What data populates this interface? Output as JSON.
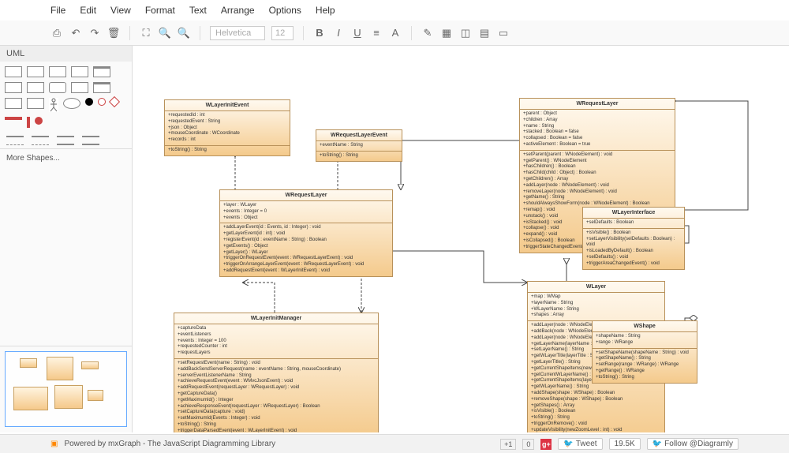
{
  "menu": {
    "file": "File",
    "edit": "Edit",
    "view": "View",
    "format": "Format",
    "text": "Text",
    "arrange": "Arrange",
    "options": "Options",
    "help": "Help"
  },
  "toolbar": {
    "font": "Helvetica",
    "size": "12"
  },
  "sidebar": {
    "title": "UML",
    "more": "More Shapes..."
  },
  "uml_boxes": {
    "wlayerInitEvent": {
      "title": "WLayerInitEvent",
      "attrs": "+requestedId : int\n+requestedEvent : String\n+json : Object\n+mouseCoordinate : WCoordinate\n+records : int",
      "ops": "+toString() : String"
    },
    "wRequestLayerEvent": {
      "title": "WRequestLayerEvent",
      "attrs": "+eventName : String",
      "ops": "+toString() : String"
    },
    "wRequestLayer": {
      "title": "WRequestLayer",
      "attrs": "+layer : WLayer\n+events : Integer = 0\n+events : Object",
      "ops": "+addLayerEvent(id : Events, id : Integer) : void\n+getLayerEvent(id : int) : void\n+registerEvent(id : eventName : String) : Boolean\n+getEvents() : Object\n+getLayer() : WLayer\n+triggerOnRequestEvent(event : WRequestLayerEvent) : void\n+triggerOnArrangeLayerEvent(event : WRequestLayerEvent) : void\n+addRequestEvent(event : WLayerInitEvent) : void"
    },
    "wRequestLayer2": {
      "title": "WRequestLayer",
      "attrs": "+parent : Object\n+children : Array\n+name : String\n+stacked : Boolean = false\n+collapsed : Boolean = false\n+activeElement : Boolean = true",
      "ops": "+setParent(parent : WNodeElement) : void\n+getParent() : WNodeElement\n+hasChildren() : Boolean\n+hasChild(child : Object) : Boolean\n+getChildren() : Array\n+addLayer(node : WNodeElement) : void\n+removeLayer(node : WNodeElement) : void\n+getName() : String\n+shouldAlwaysShowForm(node : WNodeElement) : Boolean\n+remap() : void\n+unstack() : void\n+isStacked() : void\n+collapse() : void\n+expand() : void\n+isCollapsed() : Boolean\n+triggerStateChangedEvent() : void"
    },
    "wLayerInterface": {
      "title": "WLayerInterface",
      "attrs": "+selDefaults : Boolean",
      "ops": "+isVisible() : Boolean\n+setLayerVisibility(selDefaults : Boolean) : void\n+isLoadedByDefault() : Boolean\n+selDefaults() : void\n+triggerAreaChangedEvent() : void"
    },
    "wLayerInitManager": {
      "title": "WLayerInitManager",
      "attrs": "+captureData\n+eventListeners\n+events : Integer = 100\n+requestedCounter : int\n+requestLayers",
      "ops": "+setRequestEvent(name : String) : void\n+addBackSendServerRequest(name : eventName : String, mouseCoordinate)\n+serverEventListenerName : String\n+achieveRequestEvent(event : WMvcJsonEvent) : void\n+addRequestEvent(requestLayer : WRequestLayer) : void\n+getCaptureData()\n+getMaximumId() : Integer\n+achieveResponseEvent(requestLayer : WRequestLayer) : Boolean\n+setCaptureData(capture : void)\n+setMaximumId(Events : Integer) : void\n+toString() : String\n+triggerDataParsedEvent(event : WLayerInitEvent) : void"
    },
    "wLayer": {
      "title": "WLayer",
      "attrs": "+map : WMap\n+layerName : String\n+WLayerName : String\n+shapes : Array",
      "ops": "+addLayer(node : WNodeElement) : void\n+addBack(node : WNodeElement) : void\n+addLayer(node : WNodeElement) : void\n+getLayerName(layerName : String) : void\n+setLayerName() : String\n+getWLayerTitle(layerTitle : String) : void\n+getLayerTitle() : String\n+getCurrentShapeItems(newZoomLevel : int) : String\n+getCurrentWLayerName() : String\n+getCurrentShapeItems(layerName : String) : void\n+getWLayerName() : String\n+addShape(shape : WShape) : Boolean\n+removeShape(shape : WShape) : Boolean\n+getShapes() : Array\n+isVisible() : Boolean\n+toString() : String\n+triggerOnRemove() : void\n+updateVisibility(newZoomLevel : int) : void\n+updateParentVisibility(parent : WNodeElement) : void"
    },
    "wShape": {
      "title": "WShape",
      "attrs": "+shapeName : String\n+range : WRange",
      "ops": "+setShapeName(shapeName : String) : void\n+getShapeName() : String\n+setRange(range : WRange) : WRange\n+getRange() : WRange\n+toString() : String"
    }
  },
  "footer": {
    "powered": "Powered by mxGraph - The JavaScript Diagramming Library",
    "plus1_count": "0",
    "tweet": "Tweet",
    "tweet_count": "19.5K",
    "follow": "Follow @Diagramly"
  }
}
